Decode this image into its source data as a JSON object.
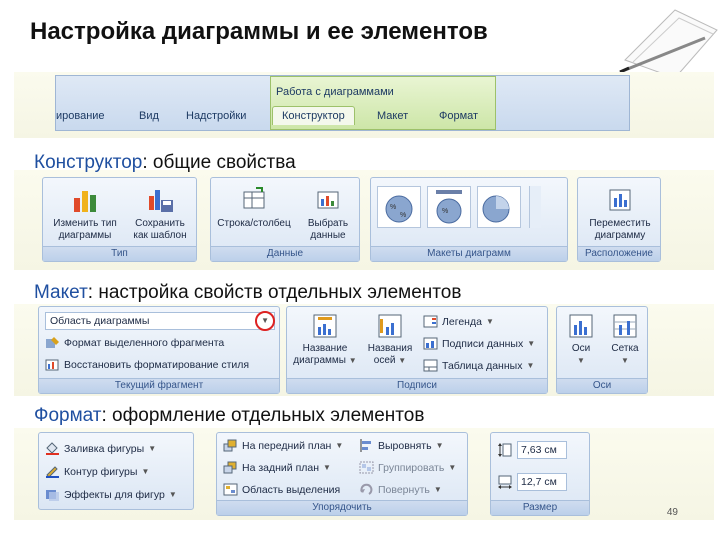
{
  "slide": {
    "title": "Настройка диаграммы и ее элементов",
    "page_number": "49"
  },
  "ribbon_header": {
    "context_title": "Работа с диаграммами",
    "tabs": [
      "ирование",
      "Вид",
      "Надстройки",
      "Конструктор",
      "Макет",
      "Формат"
    ],
    "active_tab": "Конструктор"
  },
  "sections": {
    "konstruktor": {
      "keyword": "Конструктор",
      "rest": ": общие свойства"
    },
    "maket": {
      "keyword": "Макет",
      "rest": ": настройка свойств отдельных элементов"
    },
    "format": {
      "keyword": "Формат",
      "rest": ": оформление отдельных элементов"
    }
  },
  "konstruktor_ribbon": {
    "type_group": {
      "label": "Тип",
      "change_type": {
        "line1": "Изменить тип",
        "line2": "диаграммы"
      },
      "save_template": {
        "line1": "Сохранить",
        "line2": "как шаблон"
      }
    },
    "data_group": {
      "label": "Данные",
      "row_col": {
        "line1": "Строка/столбец"
      },
      "select_data": {
        "line1": "Выбрать",
        "line2": "данные"
      }
    },
    "layouts_group": {
      "label": "Макеты диаграмм"
    },
    "location_group": {
      "label": "Расположение",
      "move_chart": {
        "line1": "Переместить",
        "line2": "диаграмму"
      }
    }
  },
  "maket_ribbon": {
    "current_group": {
      "label": "Текущий фрагмент",
      "dropdown_value": "Область диаграммы",
      "format_selection": "Формат выделенного фрагмента",
      "reset_style": "Восстановить форматирование стиля"
    },
    "labels_group": {
      "label": "Подписи",
      "chart_title": {
        "line1": "Название",
        "line2": "диаграммы"
      },
      "axis_titles": {
        "line1": "Названия",
        "line2": "осей"
      },
      "legend": "Легенда",
      "data_labels": "Подписи данных",
      "data_table": "Таблица данных"
    },
    "axes_group": {
      "label": "Оси",
      "axes": "Оси",
      "gridlines": "Сетка"
    }
  },
  "format_ribbon": {
    "shape_styles": {
      "fill": "Заливка фигуры",
      "outline": "Контур фигуры",
      "effects": "Эффекты для фигур"
    },
    "arrange_group": {
      "label": "Упорядочить",
      "bring_forward": "На передний план",
      "send_backward": "На задний план",
      "selection_pane": "Область выделения",
      "align": "Выровнять",
      "group": "Группировать",
      "rotate": "Повернуть"
    },
    "size_group": {
      "label": "Размер",
      "height": "7,63 см",
      "width": "12,7 см"
    }
  }
}
